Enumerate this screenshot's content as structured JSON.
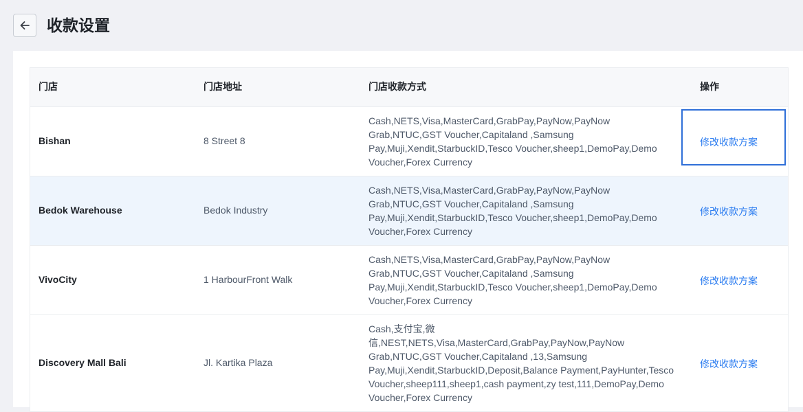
{
  "header": {
    "title": "收款设置",
    "back_icon": "arrow-left-icon"
  },
  "table": {
    "columns": [
      "门店",
      "门店地址",
      "门店收款方式",
      "操作"
    ],
    "rows": [
      {
        "store": "Bishan",
        "address": "8 Street 8",
        "methods": "Cash,NETS,Visa,MasterCard,GrabPay,PayNow,PayNow Grab,NTUC,GST Voucher,Capitaland ,Samsung Pay,Muji,Xendit,StarbuckID,Tesco Voucher,sheep1,DemoPay,Demo Voucher,Forex Currency",
        "action": "修改收款方案"
      },
      {
        "store": "Bedok Warehouse",
        "address": "Bedok Industry",
        "methods": "Cash,NETS,Visa,MasterCard,GrabPay,PayNow,PayNow Grab,NTUC,GST Voucher,Capitaland ,Samsung Pay,Muji,Xendit,StarbuckID,Tesco Voucher,sheep1,DemoPay,Demo Voucher,Forex Currency",
        "action": "修改收款方案"
      },
      {
        "store": "VivoCity",
        "address": "1 HarbourFront Walk",
        "methods": "Cash,NETS,Visa,MasterCard,GrabPay,PayNow,PayNow Grab,NTUC,GST Voucher,Capitaland ,Samsung Pay,Muji,Xendit,StarbuckID,Tesco Voucher,sheep1,DemoPay,Demo Voucher,Forex Currency",
        "action": "修改收款方案"
      },
      {
        "store": "Discovery Mall Bali",
        "address": "Jl. Kartika Plaza",
        "methods": "Cash,支付宝,微信,NEST,NETS,Visa,MasterCard,GrabPay,PayNow,PayNow Grab,NTUC,GST Voucher,Capitaland ,13,Samsung Pay,Muji,Xendit,StarbuckID,Deposit,Balance Payment,PayHunter,Tesco Voucher,sheep111,sheep1,cash payment,zy test,111,DemoPay,Demo Voucher,Forex Currency",
        "action": "修改收款方案"
      }
    ]
  },
  "colors": {
    "link": "#2b7cf0",
    "hover_row": "#eef5fd",
    "focus_outline": "#2f6fd8"
  }
}
